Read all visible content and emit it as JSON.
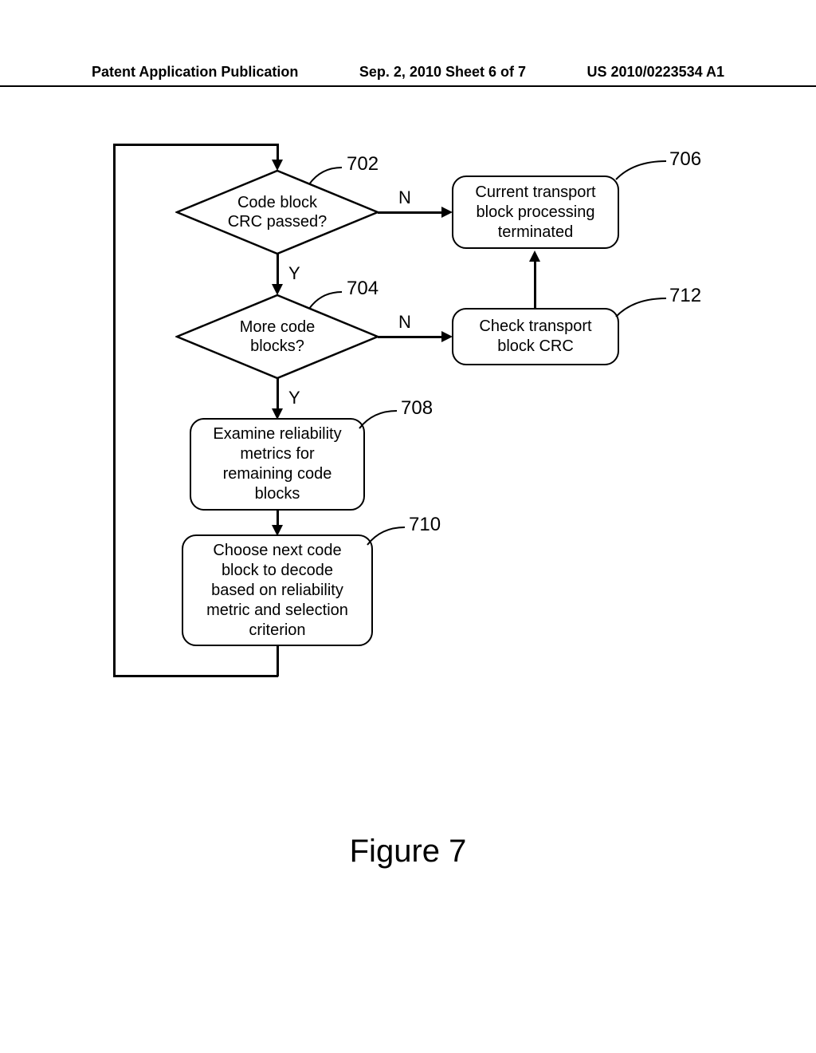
{
  "header": {
    "left": "Patent Application Publication",
    "center": "Sep. 2, 2010  Sheet 6 of 7",
    "right": "US 2010/0223534 A1"
  },
  "figure_title": "Figure 7",
  "nodes": {
    "n702": {
      "ref": "702",
      "text_line1": "Code block",
      "text_line2": "CRC passed?"
    },
    "n704": {
      "ref": "704",
      "text_line1": "More code",
      "text_line2": "blocks?"
    },
    "n706": {
      "ref": "706",
      "text_line1": "Current transport",
      "text_line2": "block processing",
      "text_line3": "terminated"
    },
    "n708": {
      "ref": "708",
      "text_line1": "Examine reliability",
      "text_line2": "metrics for",
      "text_line3": "remaining code",
      "text_line4": "blocks"
    },
    "n710": {
      "ref": "710",
      "text_line1": "Choose next code",
      "text_line2": "block to decode",
      "text_line3": "based on reliability",
      "text_line4": "metric and selection",
      "text_line5": "criterion"
    },
    "n712": {
      "ref": "712",
      "text_line1": "Check transport",
      "text_line2": "block CRC"
    }
  },
  "labels": {
    "yes": "Y",
    "no": "N"
  }
}
